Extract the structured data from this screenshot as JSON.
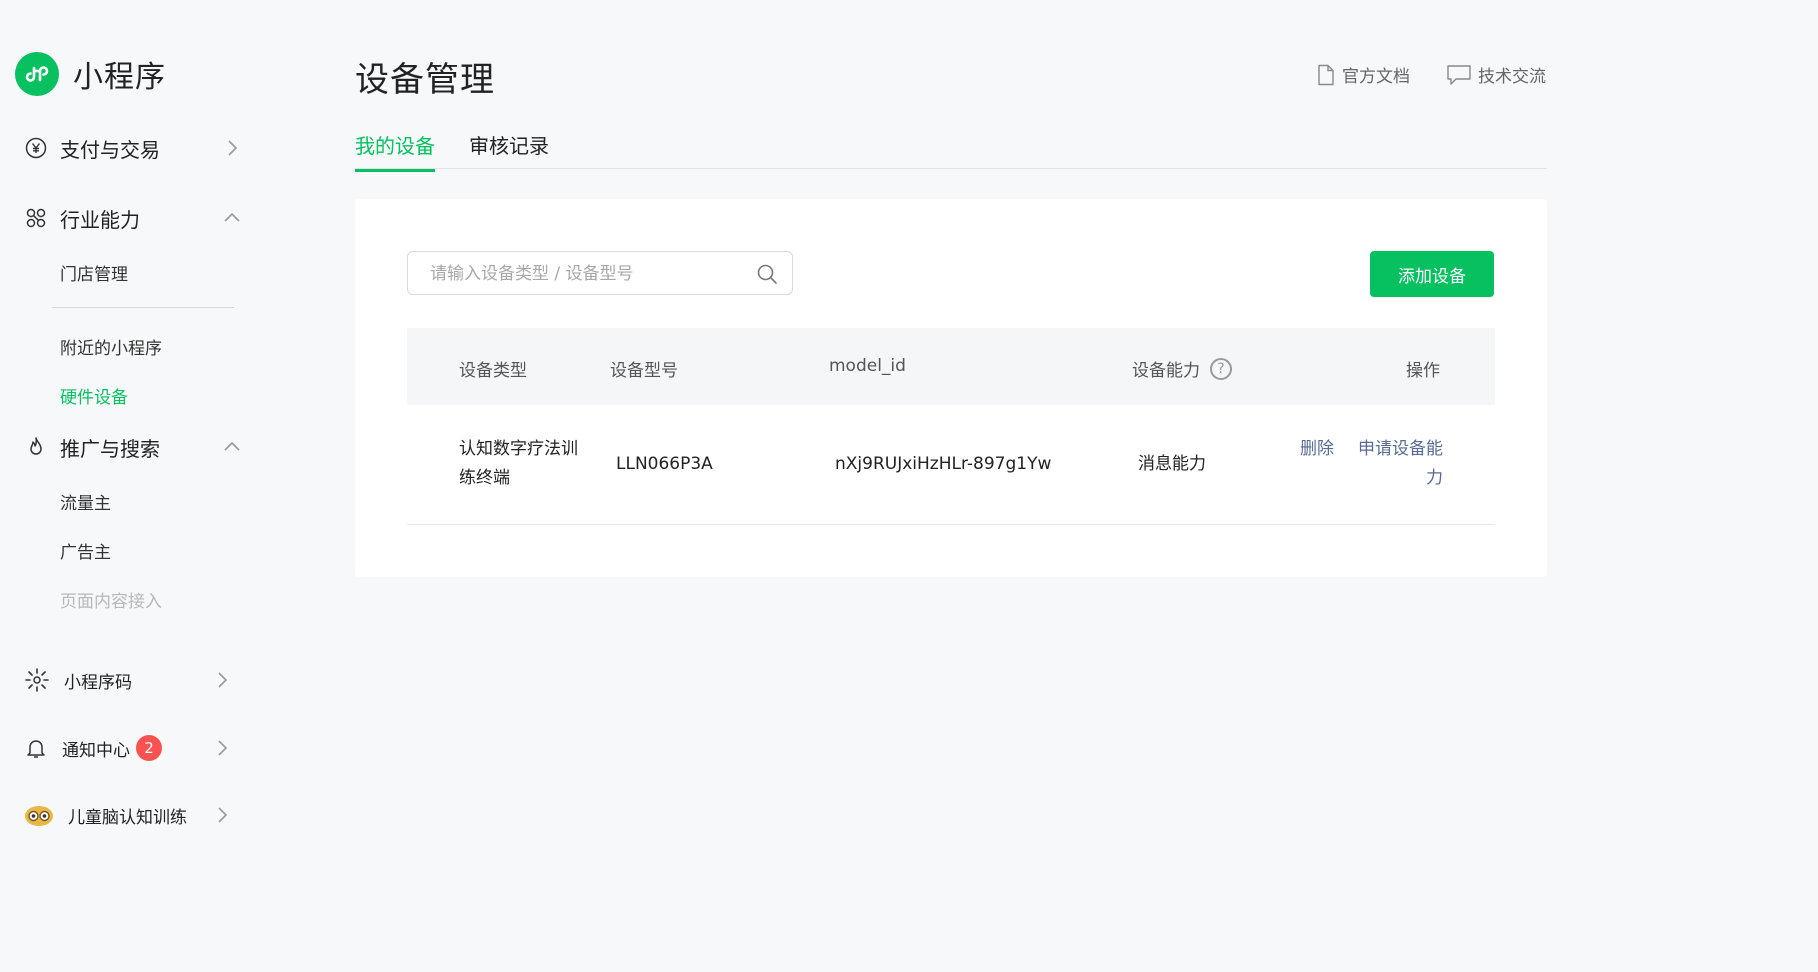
{
  "brand": {
    "title": "小程序"
  },
  "sidebar": {
    "groups": [
      {
        "label": "支付与交易",
        "icon": "yuan-circle-icon",
        "expanded": false
      },
      {
        "label": "行业能力",
        "icon": "industry-nodes-icon",
        "expanded": true,
        "items": [
          "门店管理",
          "附近的小程序",
          "硬件设备"
        ]
      },
      {
        "label": "推广与搜索",
        "icon": "flame-icon",
        "expanded": true,
        "items": [
          "流量主",
          "广告主",
          "页面内容接入"
        ]
      }
    ],
    "active_item": "硬件设备",
    "disabled_item": "页面内容接入",
    "bottom": {
      "qrcode_label": "小程序码",
      "notify_label": "通知中心",
      "notify_count": "2",
      "account_label": "儿童脑认知训练"
    }
  },
  "header": {
    "title": "设备管理",
    "doc_link": "官方文档",
    "community_link": "技术交流"
  },
  "tabs": [
    {
      "label": "我的设备",
      "active": true
    },
    {
      "label": "审核记录",
      "active": false
    }
  ],
  "toolbar": {
    "search_placeholder": "请输入设备类型 / 设备型号",
    "search_value": "",
    "add_label": "添加设备"
  },
  "table": {
    "headers": [
      "设备类型",
      "设备型号",
      "model_id",
      "设备能力",
      "操作"
    ],
    "help_glyph": "?",
    "rows": [
      {
        "type_line1": "认知数字疗法训",
        "type_line2": "练终端",
        "model": "LLN066P3A",
        "model_id": "nXj9RUJxiHzHLr-897g1Yw",
        "capability": "消息能力",
        "action_delete": "删除",
        "action_apply_line1": "申请设备能",
        "action_apply_line2": "力"
      }
    ]
  },
  "colors": {
    "accent": "#07c160",
    "link": "#576b95",
    "badge": "#fa5151"
  }
}
